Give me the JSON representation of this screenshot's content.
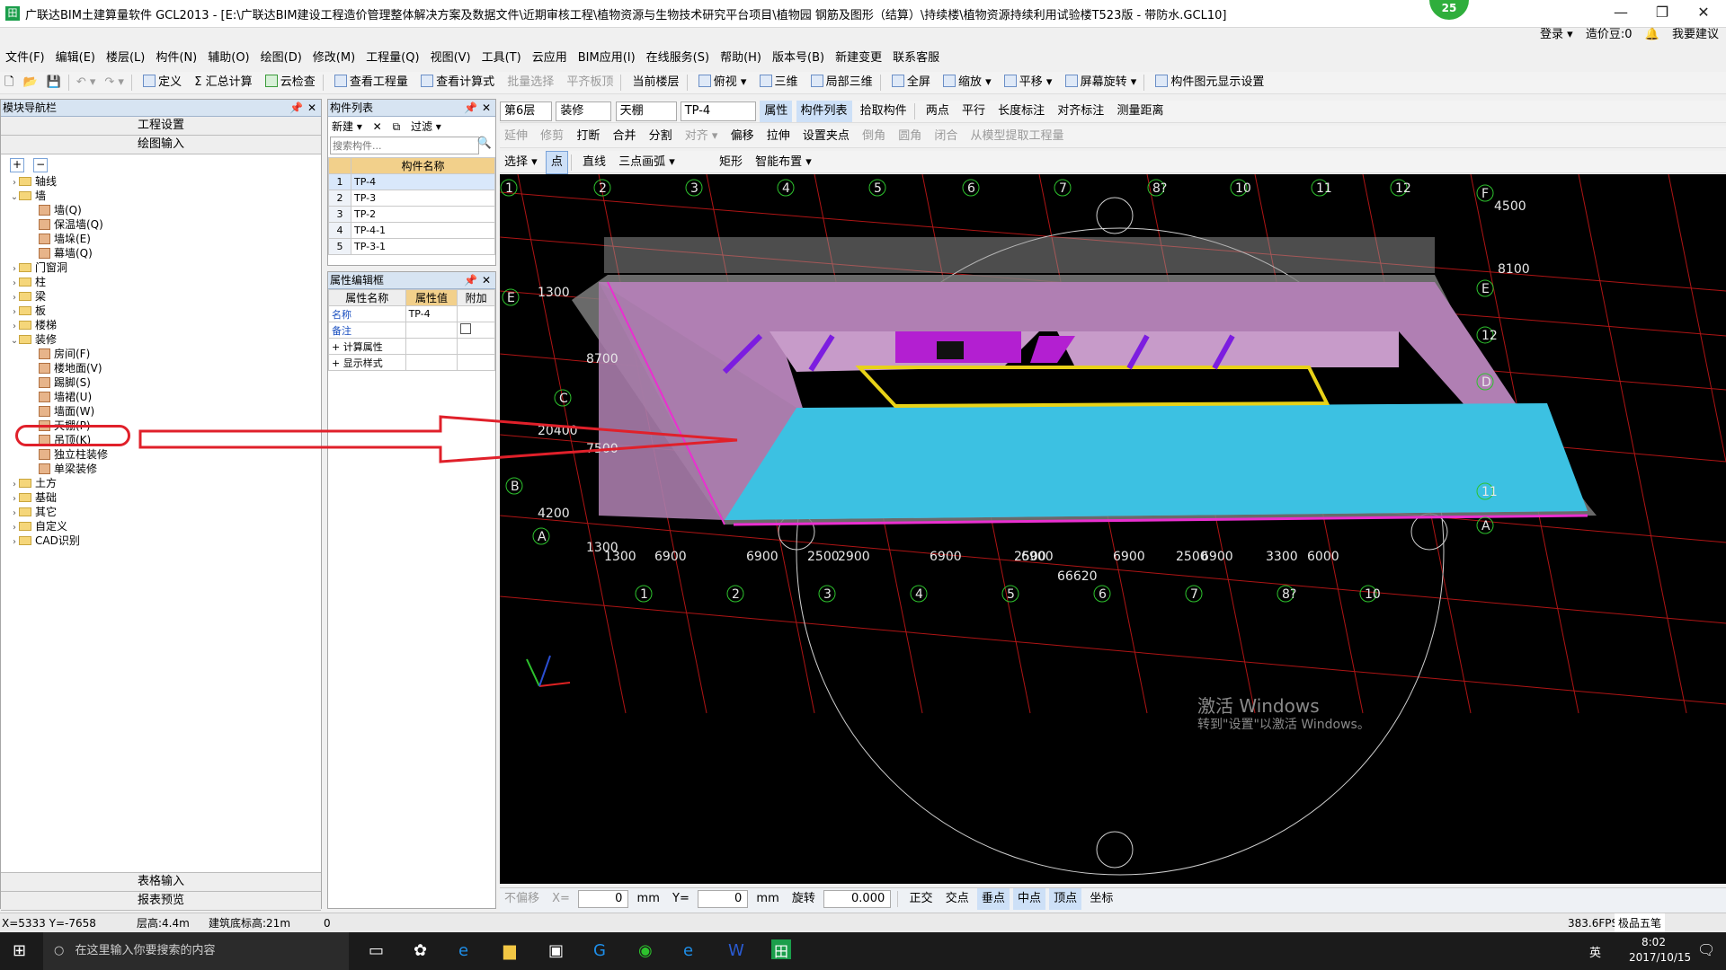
{
  "window": {
    "title": "广联达BIM土建算量软件 GCL2013 - [E:\\广联达BIM建设工程造价管理整体解决方案及数据文件\\近期审核工程\\植物资源与生物技术研究平台项目\\植物园 钢筋及图形（结算）\\持续楼\\植物资源持续利用试验楼T523版 - 带防水.GCL10]",
    "badge": "25",
    "min": "—",
    "restore": "❐",
    "close": "✕"
  },
  "account": {
    "login": "登录 ▾",
    "beans": "造价豆:0",
    "suggest": "我要建议"
  },
  "menu": [
    "文件(F)",
    "编辑(E)",
    "楼层(L)",
    "构件(N)",
    "辅助(O)",
    "绘图(D)",
    "修改(M)",
    "工程量(Q)",
    "视图(V)",
    "工具(T)",
    "云应用",
    "BIM应用(I)",
    "在线服务(S)",
    "帮助(H)",
    "版本号(B)",
    "新建变更",
    "联系客服"
  ],
  "toolbar1": [
    "定义",
    "Σ 汇总计算",
    "云检查",
    "查看工程量",
    "查看计算式",
    "批量选择",
    "平齐板顶",
    "当前楼层",
    "俯视 ▾",
    "三维",
    "局部三维",
    "全屏",
    "缩放 ▾",
    "平移 ▾",
    "屏幕旋转 ▾",
    "构件图元显示设置"
  ],
  "toolbar2": {
    "floor": "第6层",
    "category": "装修",
    "type": "天棚",
    "comp": "TP-4",
    "buttons": [
      "属性",
      "构件列表",
      "拾取构件",
      "两点",
      "平行",
      "长度标注",
      "对齐标注",
      "测量距离"
    ]
  },
  "toolbar3": [
    "延伸",
    "修剪",
    "打断",
    "合并",
    "分割",
    "对齐 ▾",
    "偏移",
    "拉伸",
    "设置夹点",
    "倒角",
    "圆角",
    "闭合",
    "从模型提取工程量"
  ],
  "toolbar4": [
    "选择 ▾",
    "点",
    "直线",
    "三点画弧 ▾",
    "矩形",
    "智能布置 ▾"
  ],
  "nav": {
    "header": "模块导航栏",
    "btn1": "工程设置",
    "btn2": "绘图输入",
    "tree": [
      {
        "label": "轴线",
        "level": 0,
        "exp": "+"
      },
      {
        "label": "墙",
        "level": 0,
        "exp": "−"
      },
      {
        "label": "墙(Q)",
        "level": 1
      },
      {
        "label": "保温墙(Q)",
        "level": 1
      },
      {
        "label": "墙垛(E)",
        "level": 1
      },
      {
        "label": "幕墙(Q)",
        "level": 1
      },
      {
        "label": "门窗洞",
        "level": 0,
        "exp": "+"
      },
      {
        "label": "柱",
        "level": 0,
        "exp": "+"
      },
      {
        "label": "梁",
        "level": 0,
        "exp": "+"
      },
      {
        "label": "板",
        "level": 0,
        "exp": "+"
      },
      {
        "label": "楼梯",
        "level": 0,
        "exp": "+"
      },
      {
        "label": "装修",
        "level": 0,
        "exp": "−"
      },
      {
        "label": "房间(F)",
        "level": 1
      },
      {
        "label": "楼地面(V)",
        "level": 1
      },
      {
        "label": "踢脚(S)",
        "level": 1
      },
      {
        "label": "墙裙(U)",
        "level": 1
      },
      {
        "label": "墙面(W)",
        "level": 1
      },
      {
        "label": "天棚(P)",
        "level": 1
      },
      {
        "label": "吊顶(K)",
        "level": 1
      },
      {
        "label": "独立柱装修",
        "level": 1
      },
      {
        "label": "单梁装修",
        "level": 1
      },
      {
        "label": "土方",
        "level": 0,
        "exp": "+"
      },
      {
        "label": "基础",
        "level": 0,
        "exp": "+"
      },
      {
        "label": "其它",
        "level": 0,
        "exp": "+"
      },
      {
        "label": "自定义",
        "level": 0,
        "exp": "+"
      },
      {
        "label": "CAD识别",
        "level": 0,
        "exp": "+"
      }
    ],
    "bottom1": "表格输入",
    "bottom2": "报表预览"
  },
  "complist": {
    "header": "构件列表",
    "new": "新建 ▾",
    "filter": "过滤 ▾",
    "search_placeholder": "搜索构件...",
    "col": "构件名称",
    "rows": [
      [
        "1",
        "TP-4"
      ],
      [
        "2",
        "TP-3"
      ],
      [
        "3",
        "TP-2"
      ],
      [
        "4",
        "TP-4-1"
      ],
      [
        "5",
        "TP-3-1"
      ]
    ]
  },
  "props": {
    "header": "属性编辑框",
    "cols": [
      "属性名称",
      "属性值",
      "附加"
    ],
    "rows": [
      [
        "名称",
        "TP-4"
      ],
      [
        "备注",
        ""
      ],
      [
        "计算属性",
        ""
      ],
      [
        "显示样式",
        ""
      ]
    ]
  },
  "viewport": {
    "top_axis": [
      "1",
      "2",
      "3",
      "4",
      "5",
      "6",
      "7",
      "8?",
      "10",
      "11",
      "12"
    ],
    "bottom_axis": [
      "1",
      "2",
      "3",
      "4",
      "5",
      "6",
      "7",
      "8?",
      "10"
    ],
    "side_axis": [
      "E",
      "C",
      "B",
      "A"
    ],
    "right_axis": [
      "F",
      "E",
      "12",
      "D",
      "11",
      "A"
    ],
    "dims_bottom": [
      "1300",
      "6900",
      "6900",
      "2500",
      "2900",
      "6900",
      "2500",
      "6900",
      "6900",
      "2500",
      "6900",
      "3300",
      "6000"
    ],
    "total": "66620",
    "dims_left": [
      "1300",
      "8700",
      "20400",
      "7500",
      "4200",
      "1300"
    ],
    "dims_right": [
      "4500",
      "8100"
    ],
    "activate1": "激活 Windows",
    "activate2": "转到\"设置\"以激活 Windows。"
  },
  "bottombar": {
    "noshift": "不偏移",
    "x_label": "X=",
    "x": "0",
    "unit": "mm",
    "y_label": "Y=",
    "y": "0",
    "rotate": "旋转",
    "angle": "0.000",
    "snap": [
      "正交",
      "交点",
      "垂点",
      "中点",
      "顶点",
      "坐标"
    ]
  },
  "status": {
    "coords": "X=5333 Y=-7658",
    "floor_h": "层高:4.4m",
    "bottom_h": "建筑底标高:21m",
    "zero": "0",
    "fps": "383.6FPS",
    "ime": "极品五笔"
  },
  "taskbar": {
    "search": "在这里输入你要搜索的内容",
    "time": "8:02",
    "date": "2017/10/15",
    "lang": "英"
  }
}
